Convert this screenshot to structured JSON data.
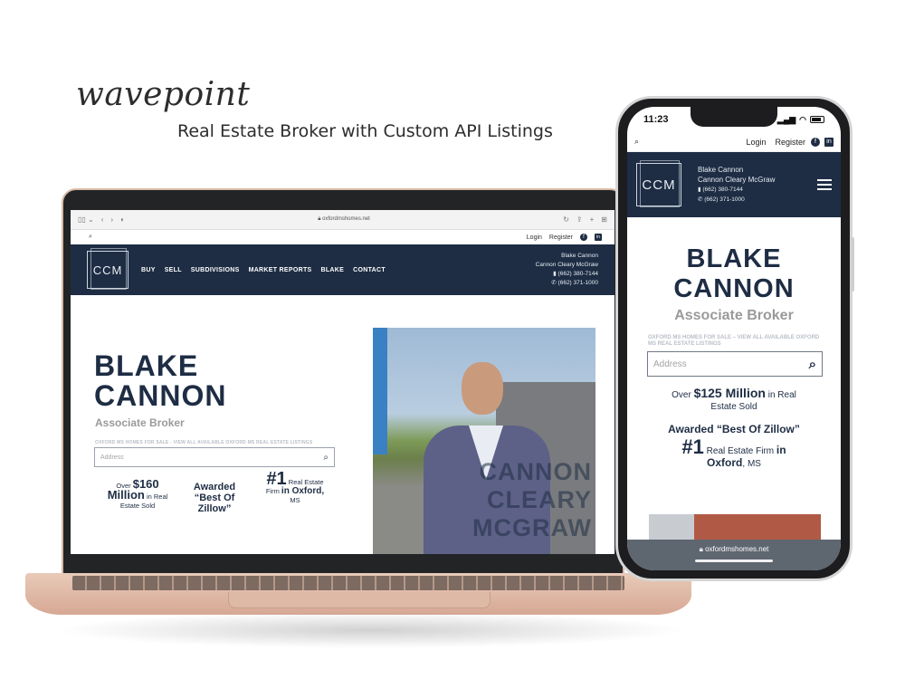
{
  "brand": {
    "logo": "wavepoint",
    "tagline": "Real Estate Broker with Custom API Listings"
  },
  "browser": {
    "url": "oxfordmshomes.net"
  },
  "site": {
    "util": {
      "login": "Login",
      "register": "Register"
    },
    "nav": [
      "BUY",
      "SELL",
      "SUBDIVISIONS",
      "MARKET REPORTS",
      "BLAKE",
      "CONTACT"
    ],
    "logo": "CCM",
    "contact": {
      "name": "Blake Cannon",
      "firm": "Cannon Cleary McGraw",
      "phone1": "(662) 380-7144",
      "phone2": "(662) 371-1000"
    },
    "hero": {
      "name_line1": "BLAKE",
      "name_line2": "CANNON",
      "role": "Associate Broker",
      "sub_desktop": "OXFORD MS HOMES FOR SALE - VIEW ALL AVAILABLE OXFORD MS REAL ESTATE LISTINGS",
      "sub_mobile": "OXFORD MS HOMES FOR SALE – VIEW ALL AVAILABLE OXFORD MS REAL ESTATE LISTINGS",
      "search_placeholder": "Address",
      "overlay_line1": "CANNON",
      "overlay_line2": "CLEARY",
      "overlay_line3": "MCGRAW"
    },
    "stats_desktop": {
      "s1_pre": "Over",
      "s1_big": "$160",
      "s1_big2": "Million",
      "s1_post": "in Real",
      "s1_post2": "Estate Sold",
      "s2_line1": "Awarded",
      "s2_line2": "“Best Of",
      "s2_line3": "Zillow”",
      "s3_big": "#1",
      "s3_post": "Real Estate",
      "s3_firm": "Firm",
      "s3_in": "in Oxford,",
      "s3_state": "MS"
    },
    "stats_mobile": {
      "s1_pre": "Over",
      "s1_big": "$125 Million",
      "s1_post": "in Real",
      "s1_post2": "Estate Sold",
      "s2": "Awarded “Best Of Zillow”",
      "s3_big": "#1",
      "s3_post": "Real Estate Firm",
      "s3_in": "in",
      "s3_city": "Oxford",
      "s3_state": ", MS"
    }
  },
  "phone": {
    "time": "11:23",
    "footer_url": "oxfordmshomes.net"
  },
  "icons": {
    "search": "search-icon",
    "facebook": "facebook-icon",
    "linkedin": "linkedin-icon",
    "menu": "hamburger-menu-icon",
    "phone": "phone-icon"
  },
  "colors": {
    "navy": "#1e2d44",
    "gray": "#9a9a9a",
    "laptop": "#e2bca9"
  }
}
